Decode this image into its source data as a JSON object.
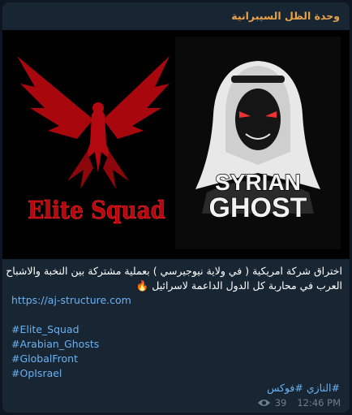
{
  "channel": {
    "name": "وحدة الظل السيبرانية"
  },
  "media": {
    "left_logo_text": "Elite Squad",
    "right_logo_line1": "SYRIAN",
    "right_logo_line2": "GHOST",
    "colors": {
      "elite_red": "#b3080f",
      "ghost_panel": "#0a0a0a",
      "ghost_text": "#f2f2f2"
    }
  },
  "message": {
    "line1": "اختراق شركة امريكية ( في ولاية نيوجيرسي ) بعملية مشتركة بين النخبة والاشباح",
    "line2": "العرب في محاربة كل الدول الداعمة لاسرائيل 🔥",
    "link": "https://aj-structure.com",
    "hashtags": [
      "#Elite_Squad",
      "#Arabian_Ghosts",
      "#GlobalFront",
      "#OpIsrael"
    ],
    "hashtag_rtl": "#النازي #فوكس"
  },
  "meta": {
    "views": "39",
    "time": "12:46 PM",
    "views_icon": "eye-icon"
  },
  "colors": {
    "bubble": "#182533",
    "background": "#0e1621",
    "channel_name": "#e8a24a",
    "link": "#6ab2f2",
    "meta": "#6d7f8f"
  }
}
